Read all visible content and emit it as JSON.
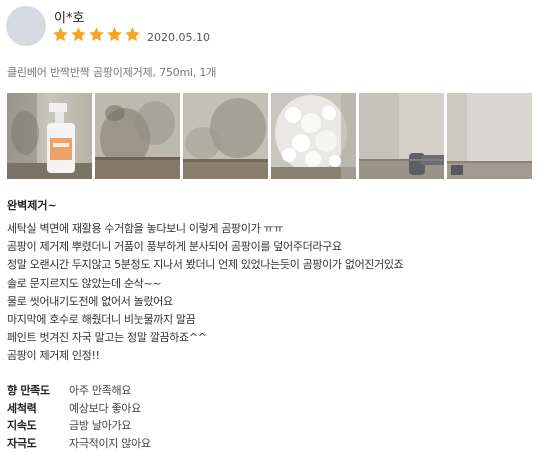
{
  "reviewer": {
    "name": "이*호",
    "date": "2020.05.10",
    "rating": 5
  },
  "product": {
    "option_text": "클린베어 반짝반짝 곰팡이제거제, 750ml, 1개"
  },
  "photos": [
    {
      "label": "photo-1"
    },
    {
      "label": "photo-2"
    },
    {
      "label": "photo-3"
    },
    {
      "label": "photo-4"
    },
    {
      "label": "photo-5"
    },
    {
      "label": "photo-6"
    }
  ],
  "review": {
    "title": "완벽제거~",
    "lines": [
      "세탁실 벽면에 재활용 수거함을 놓다보니 이렇게 곰팡이가 ㅠㅠ",
      "곰팡이 제거제 뿌렸더니 거품이 풍부하게 분사되어 곰팡이를 덮어주더라구요",
      "정말 오랜시간 두지않고 5분정도 지나서 봤더니 언제 있었나는듯이 곰팡이가 없어진거있죠",
      "솔로 문지르지도 않았는데 순삭~~",
      "물로 씻어내기도전에 없어서 놀랐어요",
      "마지막에 호수로 해줬더니 비눗물까지 말끔",
      "페인트 벗겨진 자국 말고는 정말 깔끔하죠^^",
      "곰팡이 제거제 인정!!"
    ]
  },
  "attributes": [
    {
      "label": "향 만족도",
      "value": "아주 만족해요"
    },
    {
      "label": "세척력",
      "value": "예상보다 좋아요"
    },
    {
      "label": "지속도",
      "value": "금방 날아가요"
    },
    {
      "label": "자극도",
      "value": "자극적이지 않아요"
    }
  ],
  "colors": {
    "star": "#f5a623",
    "avatar": "#d4d9e2"
  },
  "icons": {
    "star": "star-icon"
  }
}
